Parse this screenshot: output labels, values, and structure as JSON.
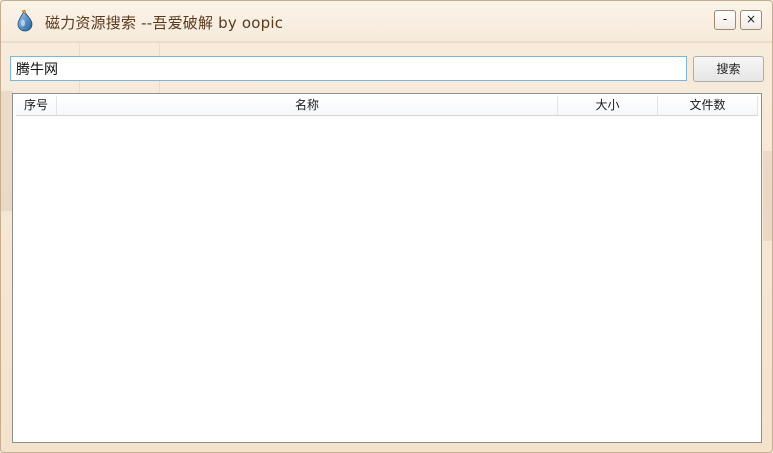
{
  "window": {
    "title": "磁力资源搜索 --吾爱破解 by oopic",
    "minimize_label": "-",
    "close_label": "×"
  },
  "search": {
    "query": "腾牛网",
    "button_label": "搜索"
  },
  "table": {
    "columns": [
      "序号",
      "名称",
      "大小",
      "文件数"
    ],
    "rows": []
  },
  "colors": {
    "frame": "#f3e2cc",
    "title_text": "#5a3a1e",
    "input_border": "#7eb4d8"
  }
}
